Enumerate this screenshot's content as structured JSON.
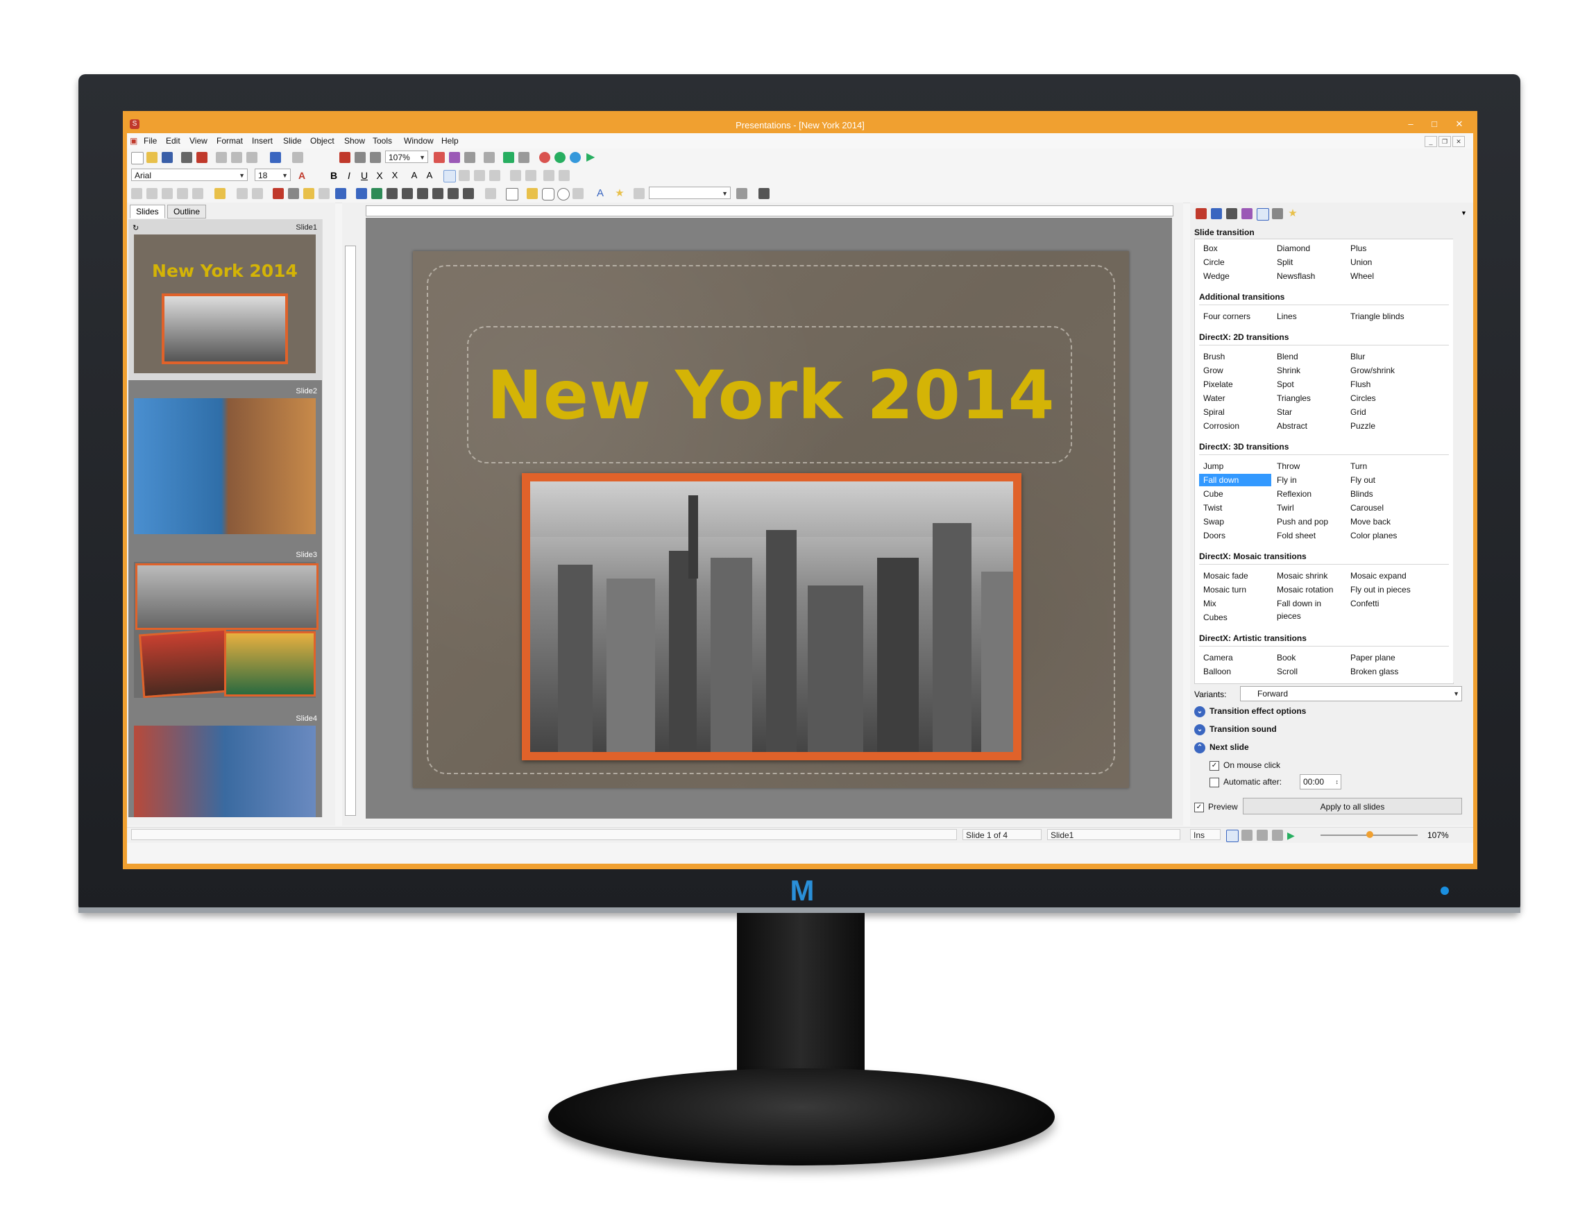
{
  "window": {
    "title": "Presentations - [New York 2014]"
  },
  "menu": [
    "File",
    "Edit",
    "View",
    "Format",
    "Insert",
    "Slide",
    "Object",
    "Show",
    "Tools",
    "Window",
    "Help"
  ],
  "toolbar": {
    "zoom": "107%",
    "font": "Arial",
    "font_size": "18"
  },
  "slides_pane": {
    "tabs": [
      "Slides",
      "Outline"
    ],
    "slides": [
      "Slide1",
      "Slide2",
      "Slide3",
      "Slide4"
    ],
    "thumb1_title": "New York 2014"
  },
  "slide": {
    "title": "New York 2014"
  },
  "sidebar": {
    "heading": "Slide transition",
    "groups": [
      {
        "title": "",
        "items": [
          "Box",
          "Diamond",
          "Plus",
          "Circle",
          "Split",
          "Union",
          "Wedge",
          "Newsflash",
          "Wheel"
        ]
      },
      {
        "title": "Additional transitions",
        "items": [
          "Four corners",
          "Lines",
          "Triangle blinds"
        ]
      },
      {
        "title": "DirectX: 2D transitions",
        "items": [
          "Brush",
          "Blend",
          "Blur",
          "Grow",
          "Shrink",
          "Grow/shrink",
          "Pixelate",
          "Spot",
          "Flush",
          "Water",
          "Triangles",
          "Circles",
          "Spiral",
          "Star",
          "Grid",
          "Corrosion",
          "Abstract",
          "Puzzle"
        ]
      },
      {
        "title": "DirectX: 3D transitions",
        "items": [
          "Jump",
          "Throw",
          "Turn",
          "Fall down",
          "Fly in",
          "Fly out",
          "Cube",
          "Reflexion",
          "Blinds",
          "Twist",
          "Twirl",
          "Carousel",
          "Swap",
          "Push and pop",
          "Move back",
          "Doors",
          "Fold sheet",
          "Color planes"
        ]
      },
      {
        "title": "DirectX: Mosaic transitions",
        "items": [
          "Mosaic fade",
          "Mosaic shrink",
          "Mosaic expand",
          "Mosaic turn",
          "Mosaic rotation",
          "Fly out in pieces",
          "Mix",
          "Fall down in pieces",
          "Confetti",
          "Cubes"
        ]
      },
      {
        "title": "DirectX: Artistic transitions",
        "items": [
          "Camera",
          "Book",
          "Paper plane",
          "Balloon",
          "Scroll",
          "Broken glass"
        ]
      }
    ],
    "selected": "Fall down",
    "variants_label": "Variants:",
    "variants_value": "Forward",
    "sections": [
      "Transition effect options",
      "Transition sound",
      "Next slide"
    ],
    "on_mouse_click": "On mouse click",
    "automatic_after": "Automatic after:",
    "time": "00:00",
    "preview": "Preview",
    "apply_all": "Apply to all slides"
  },
  "status": {
    "slide_pos": "Slide 1 of 4",
    "slide_name": "Slide1",
    "mode": "Ins",
    "zoom": "107%"
  },
  "colors": {
    "accent": "#f0a030",
    "title_yellow": "#d4b406",
    "frame_orange": "#e0622a",
    "selection": "#3399ff"
  },
  "monitor_logo": "M"
}
